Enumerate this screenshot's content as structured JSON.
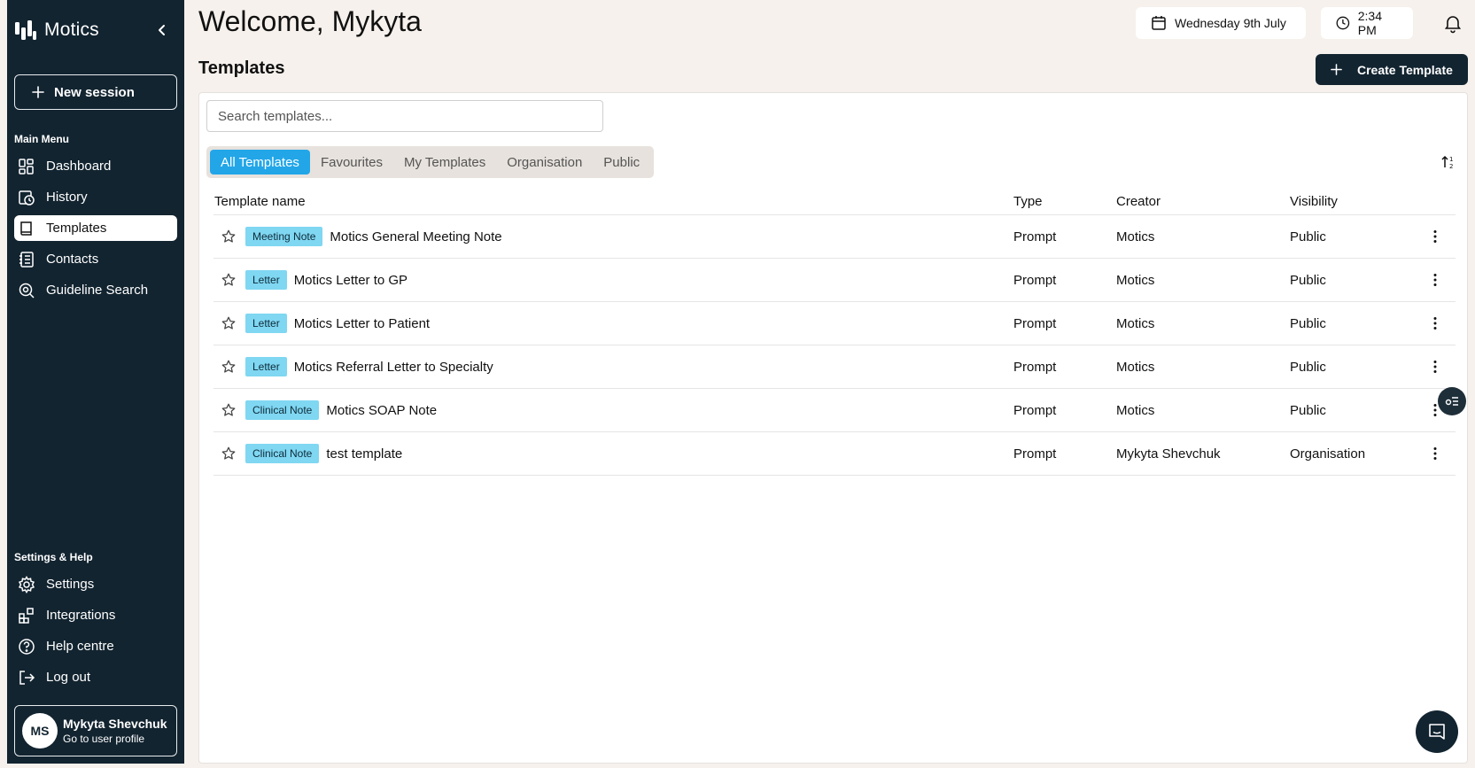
{
  "app": {
    "name": "Motics"
  },
  "sidebar": {
    "new_session": "New session",
    "main_menu_title": "Main Menu",
    "main_items": [
      {
        "label": "Dashboard",
        "icon": "dashboard-icon"
      },
      {
        "label": "History",
        "icon": "history-icon"
      },
      {
        "label": "Templates",
        "icon": "book-icon"
      },
      {
        "label": "Contacts",
        "icon": "contacts-icon"
      },
      {
        "label": "Guideline Search",
        "icon": "search-icon"
      }
    ],
    "active_item": "Templates",
    "help_title": "Settings & Help",
    "help_items": [
      {
        "label": "Settings",
        "icon": "gear-icon"
      },
      {
        "label": "Integrations",
        "icon": "integrations-icon"
      },
      {
        "label": "Help centre",
        "icon": "help-icon"
      },
      {
        "label": "Log out",
        "icon": "logout-icon"
      }
    ],
    "profile": {
      "initials": "MS",
      "name": "Mykyta Shevchuk",
      "link": "Go to user profile"
    }
  },
  "header": {
    "welcome": "Welcome, Mykyta",
    "date": "Wednesday 9th July",
    "time": "2:34 PM"
  },
  "templates": {
    "title": "Templates",
    "create_label": "Create Template",
    "search_placeholder": "Search templates...",
    "tabs": [
      "All Templates",
      "Favourites",
      "My Templates",
      "Organisation",
      "Public"
    ],
    "active_tab": "All Templates",
    "columns": {
      "name": "Template name",
      "type": "Type",
      "creator": "Creator",
      "visibility": "Visibility"
    },
    "rows": [
      {
        "tag": "Meeting Note",
        "name": "Motics General Meeting Note",
        "type": "Prompt",
        "creator": "Motics",
        "visibility": "Public"
      },
      {
        "tag": "Letter",
        "name": "Motics Letter to GP",
        "type": "Prompt",
        "creator": "Motics",
        "visibility": "Public"
      },
      {
        "tag": "Letter",
        "name": "Motics Letter to Patient",
        "type": "Prompt",
        "creator": "Motics",
        "visibility": "Public"
      },
      {
        "tag": "Letter",
        "name": "Motics Referral Letter to Specialty",
        "type": "Prompt",
        "creator": "Motics",
        "visibility": "Public"
      },
      {
        "tag": "Clinical Note",
        "name": "Motics SOAP Note",
        "type": "Prompt",
        "creator": "Motics",
        "visibility": "Public"
      },
      {
        "tag": "Clinical Note",
        "name": "test template",
        "type": "Prompt",
        "creator": "Mykyta Shevchuk",
        "visibility": "Organisation"
      }
    ]
  },
  "colors": {
    "sidebar": "#122430",
    "accent": "#22a6e8",
    "tag": "#7fd7f2",
    "background": "#f6f1ec"
  }
}
